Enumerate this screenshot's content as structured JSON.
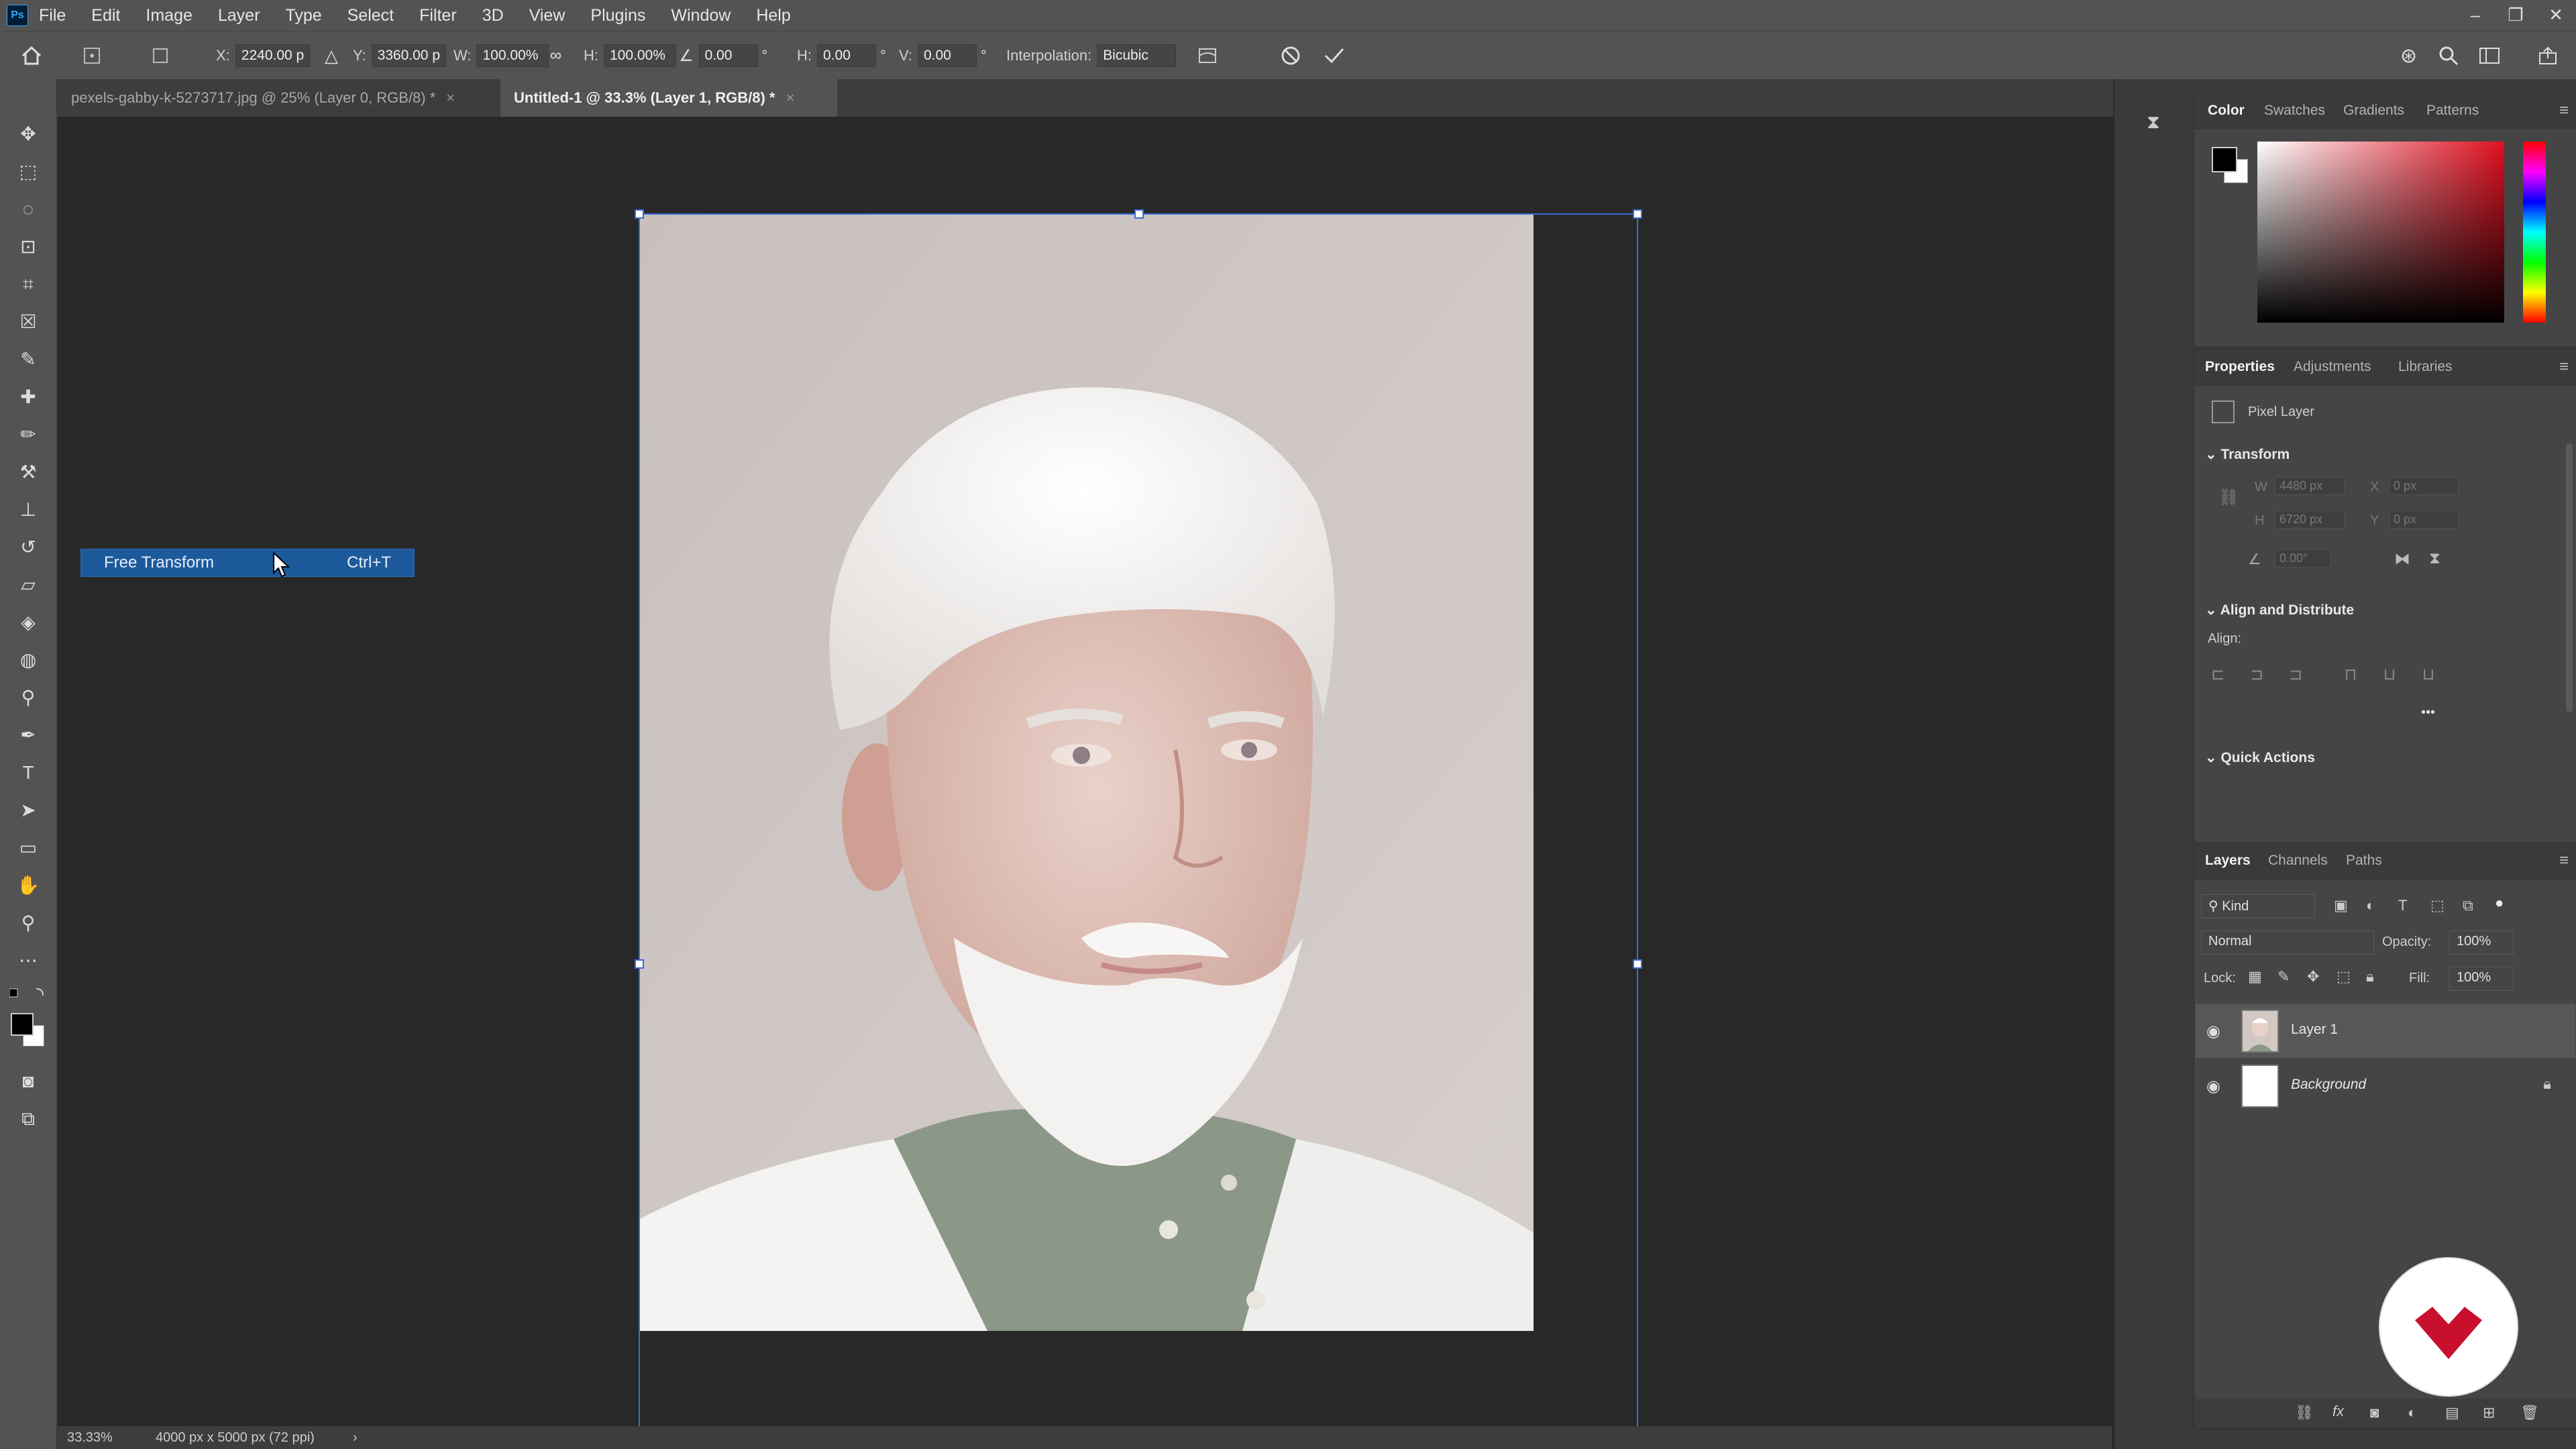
{
  "app": {
    "logo": "Ps"
  },
  "menu": [
    "File",
    "Edit",
    "Image",
    "Layer",
    "Type",
    "Select",
    "Filter",
    "3D",
    "View",
    "Plugins",
    "Window",
    "Help"
  ],
  "window_controls": {
    "minimize": "–",
    "restore": "❐",
    "close": "✕"
  },
  "options": {
    "x_label": "X:",
    "x_value": "2240.00 p",
    "y_label": "Y:",
    "y_value": "3360.00 p",
    "w_label": "W:",
    "w_value": "100.00%",
    "h_label": "H:",
    "h_value": "100.00%",
    "angle_value": "0.00",
    "angle_unit": "°",
    "skew_h_label": "H:",
    "skew_h_value": "0.00",
    "skew_v_label": "V:",
    "skew_v_value": "0.00",
    "interp_label": "Interpolation:",
    "interp_value": "Bicubic"
  },
  "tabs": [
    {
      "label": "pexels-gabby-k-5273717.jpg @ 25% (Layer 0, RGB/8) *",
      "close": "×"
    },
    {
      "label": "Untitled-1 @ 33.3% (Layer 1, RGB/8) *",
      "close": "×"
    }
  ],
  "context_menu": {
    "label": "Free Transform",
    "shortcut": "Ctrl+T"
  },
  "status": {
    "zoom": "33.33%",
    "doc_info": "4000 px x 5000 px (72 ppi)",
    "arrow": "›"
  },
  "color_panel": {
    "tabs": [
      "Color",
      "Swatches",
      "Gradients",
      "Patterns"
    ]
  },
  "properties_panel": {
    "tabs": [
      "Properties",
      "Adjustments",
      "Libraries"
    ],
    "layer_type": "Pixel Layer",
    "transform_title": "Transform",
    "w_label": "W",
    "w_value": "4480 px",
    "h_label": "H",
    "h_value": "6720 px",
    "x_label": "X",
    "x_value": "0 px",
    "y_label": "Y",
    "y_value": "0 px",
    "angle_value": "0.00°",
    "align_title": "Align and Distribute",
    "align_label": "Align:",
    "more": "•••",
    "quick_title": "Quick Actions"
  },
  "layers_panel": {
    "tabs": [
      "Layers",
      "Channels",
      "Paths"
    ],
    "kind": "Kind",
    "blend_mode": "Normal",
    "opacity_label": "Opacity:",
    "opacity_value": "100%",
    "lock_label": "Lock:",
    "fill_label": "Fill:",
    "fill_value": "100%",
    "layers": [
      {
        "name": "Layer 1",
        "visible": true,
        "selected": true
      },
      {
        "name": "Background",
        "visible": true,
        "locked": true
      }
    ],
    "footer_icons": [
      "link-icon",
      "fx-icon",
      "mask-icon",
      "adjustment-icon",
      "folder-icon",
      "new-layer-icon",
      "trash-icon"
    ]
  },
  "colors": {
    "accent": "#31a8ff",
    "selection": "#1d5a9c",
    "brand_red": "#c8102e"
  }
}
